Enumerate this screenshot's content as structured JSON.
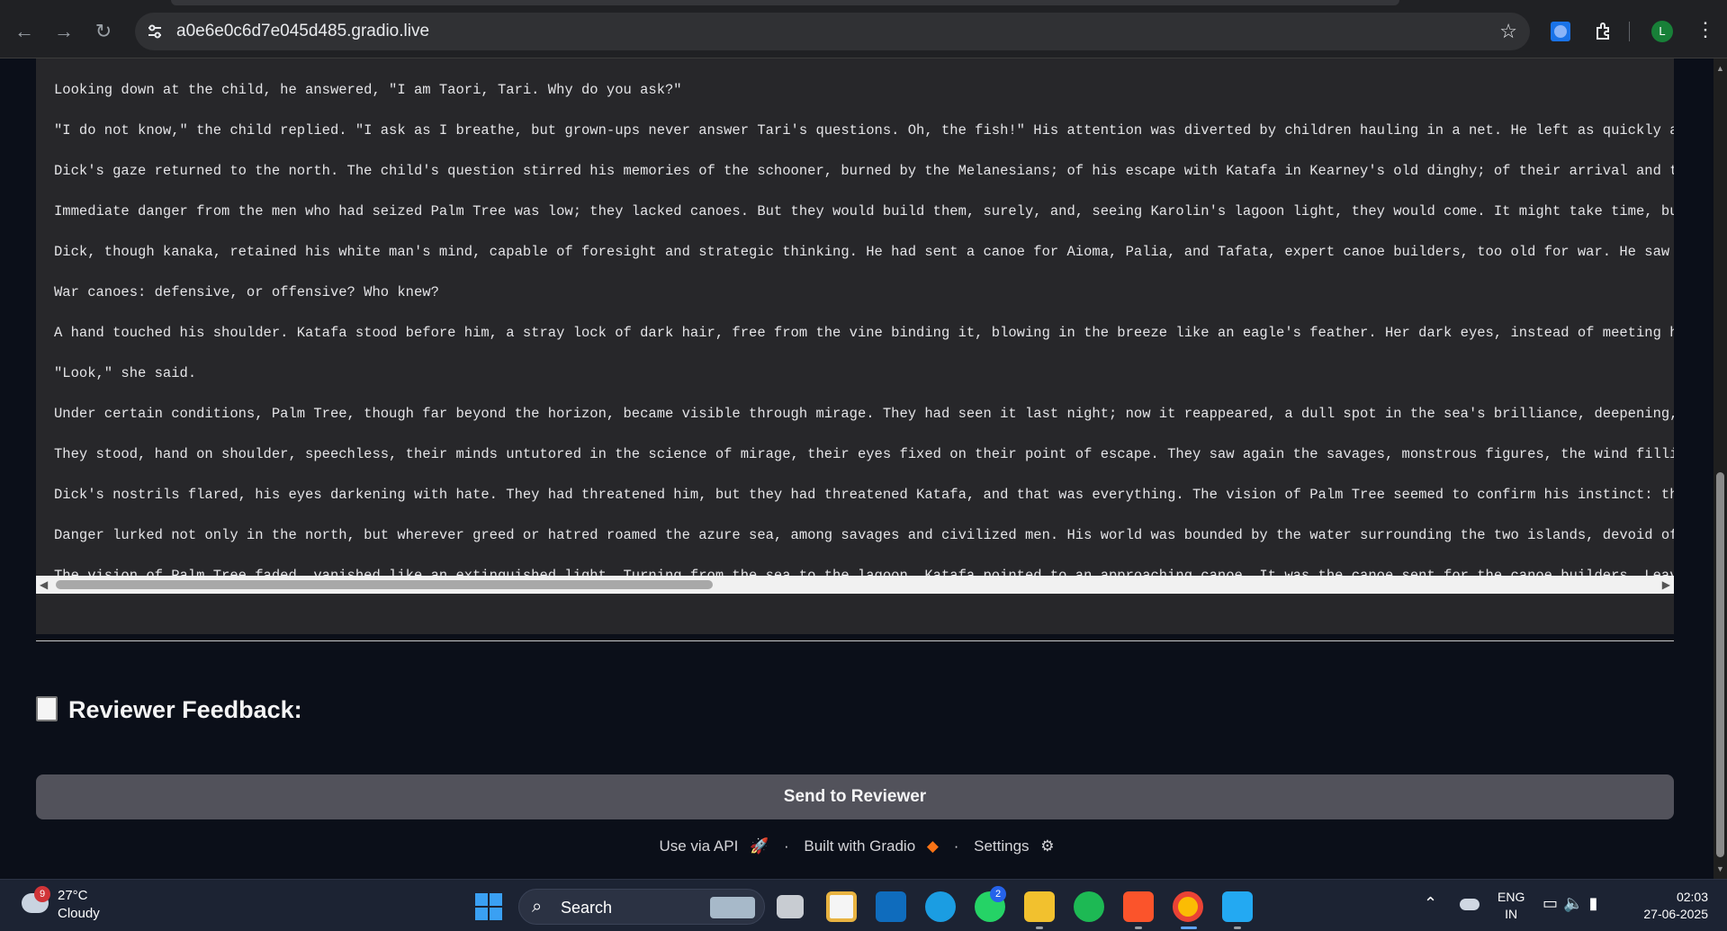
{
  "browser": {
    "url": "a0e6e0c6d7e045d485.gradio.live",
    "profile_initial": "L"
  },
  "story_lines": [
    "Looking down at the child, he answered, \"I am Taori, Tari. Why do you ask?\"",
    "\"I do not know,\" the child replied. \"I ask as I breathe, but grown-ups never answer Tari's questions. Oh, the fish!\" His attention was diverted by children hauling in a net. He left as quickly as he c",
    "Dick's gaze returned to the north. The child's question stirred his memories of the schooner, burned by the Melanesians; of his escape with Katafa in Kearney's old dinghy; of their arrival and the wom",
    "Immediate danger from the men who had seized Palm Tree was low; they lacked canoes. But they would build them, surely, and, seeing Karolin's lagoon light, they would come.  It might take time, but the",
    "Dick, though kanaka, retained his white man's mind, capable of foresight and strategic thinking.  He had sent a canoe for Aioma, Palia, and Tafata, expert canoe builders, too old for war.  He saw the",
    "War canoes:  defensive, or offensive?  Who knew?",
    "A hand touched his shoulder.  Katafa stood before him, a stray lock of dark hair, free from the vine binding it, blowing in the breeze like an eagle's feather.  Her dark eyes, instead of meeting his,",
    "\"Look,\" she said.",
    "Under certain conditions, Palm Tree, though far beyond the horizon, became visible through mirage.  They had seen it last night; now it reappeared, a dull spot in the sea's brilliance, deepening, hard",
    "They stood, hand on shoulder, speechless, their minds untutored in the science of mirage, their eyes fixed on their point of escape.  They saw again the savages, monstrous figures, the wind filling th",
    "Dick's nostrils flared, his eyes darkening with hate.  They had threatened him, but they had threatened Katafa, and that was everything.  The vision of Palm Tree seemed to confirm his instinct: they w",
    "Danger lurked not only in the north, but wherever greed or hatred roamed the azure sea, among savages and civilized men.  His world was bounded by the water surrounding the two islands, devoid of Euro",
    "The vision of Palm Tree faded, vanished like an extinguished light. Turning from the sea to the lagoon, Katafa pointed to an approaching canoe. It was the canoe sent for the canoe builders. Leaving th"
  ],
  "feedback": {
    "title": "Reviewer Feedback:",
    "icon": "scroll-icon"
  },
  "send_button": "Send to Reviewer",
  "footer": {
    "api": "Use via API",
    "built": "Built with Gradio",
    "settings": "Settings",
    "sep": "·"
  },
  "taskbar": {
    "temp": "27°C",
    "condition": "Cloudy",
    "weather_badge": "9",
    "search": "Search",
    "whatsapp_badge": "2",
    "lang1": "ENG",
    "lang2": "IN",
    "time": "02:03",
    "date": "27-06-2025"
  },
  "colors": {
    "page_bg": "#0b0f19",
    "code_bg": "#27272a",
    "button_bg": "#52525b",
    "taskbar_bg": "#1c2333"
  }
}
